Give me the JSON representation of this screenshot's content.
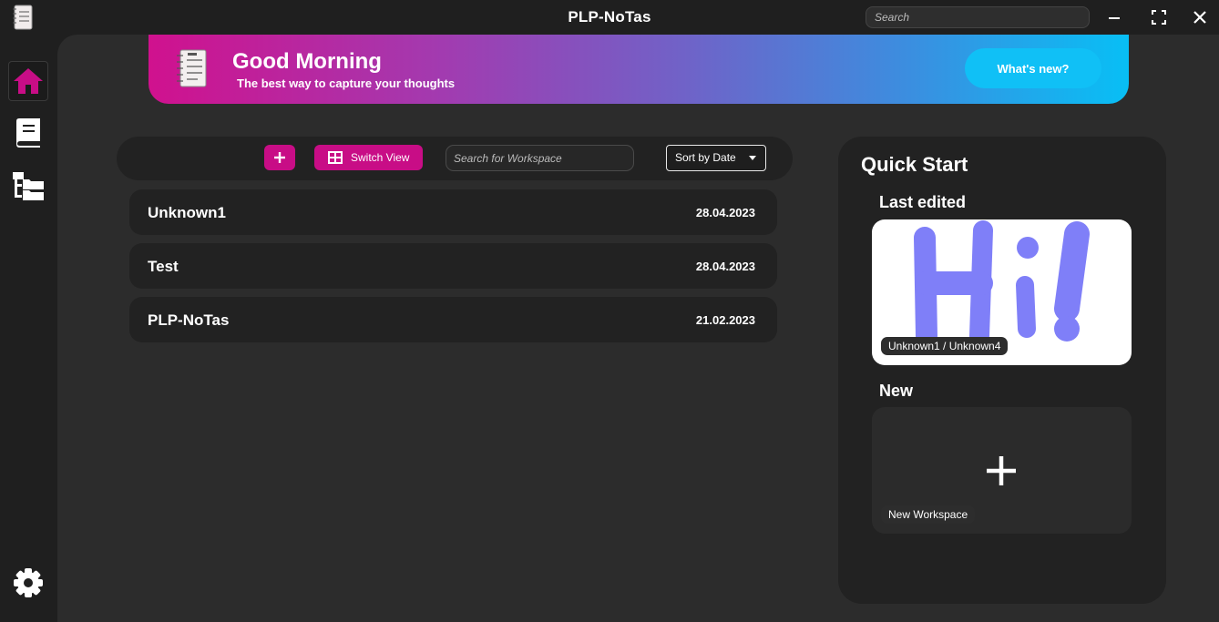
{
  "window": {
    "title": "PLP-NoTas",
    "search_placeholder": "Search"
  },
  "sidebar": {
    "items": [
      "home-icon",
      "notebook-icon",
      "workspace-tree-icon"
    ],
    "settings": "gear-icon",
    "active_color": "#c80d86"
  },
  "banner": {
    "greeting": "Good Morning",
    "tagline": "The best way to capture your thoughts",
    "whats_new": "What's new?"
  },
  "toolbar": {
    "switch_view": "Switch View",
    "search_placeholder": "Search for Workspace",
    "sort": "Sort by Date"
  },
  "workspaces": [
    {
      "name": "Unknown1",
      "date": "28.04.2023"
    },
    {
      "name": "Test",
      "date": "28.04.2023"
    },
    {
      "name": "PLP-NoTas",
      "date": "21.02.2023"
    }
  ],
  "quick_start": {
    "title": "Quick Start",
    "last_edited_title": "Last edited",
    "last_edited_label": "Unknown1 / Unknown4",
    "new_title": "New",
    "new_label": "New Workspace"
  },
  "colors": {
    "accent": "#c80d86",
    "banner_start": "#d0118e",
    "banner_end": "#08bff5",
    "sketch": "#7f7ff8"
  }
}
